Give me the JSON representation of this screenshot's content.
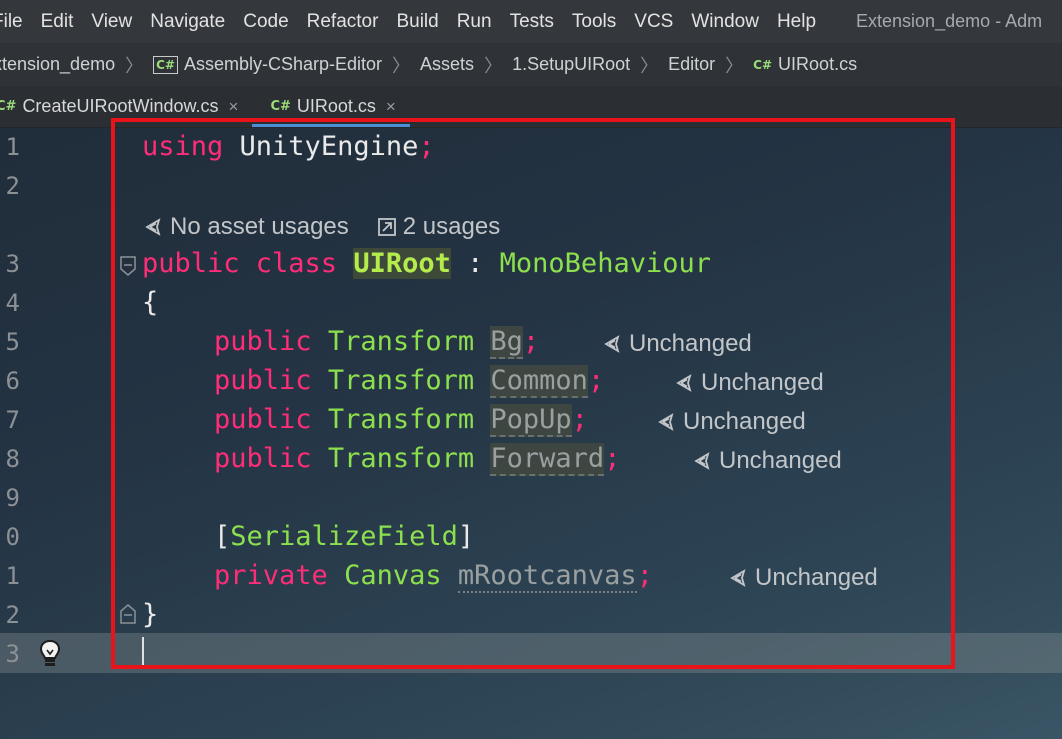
{
  "menu": {
    "items": [
      {
        "name": "menu-file",
        "label": "File"
      },
      {
        "name": "menu-edit",
        "label": "Edit"
      },
      {
        "name": "menu-view",
        "label": "View"
      },
      {
        "name": "menu-navigate",
        "label": "Navigate"
      },
      {
        "name": "menu-code",
        "label": "Code"
      },
      {
        "name": "menu-refactor",
        "label": "Refactor"
      },
      {
        "name": "menu-build",
        "label": "Build"
      },
      {
        "name": "menu-run",
        "label": "Run"
      },
      {
        "name": "menu-tests",
        "label": "Tests"
      },
      {
        "name": "menu-tools",
        "label": "Tools"
      },
      {
        "name": "menu-vcs",
        "label": "VCS"
      },
      {
        "name": "menu-window",
        "label": "Window"
      },
      {
        "name": "menu-help",
        "label": "Help"
      }
    ],
    "window_title": "Extension_demo - Adm"
  },
  "breadcrumb": {
    "items": [
      "xtension_demo",
      "Assembly-CSharp-Editor",
      "Assets",
      "1.SetupUIRoot",
      "Editor",
      "UIRoot.cs"
    ],
    "separator": "〉"
  },
  "tabs": [
    {
      "label": "CreateUIRootWindow.cs",
      "active": false
    },
    {
      "label": "UIRoot.cs",
      "active": true
    }
  ],
  "icons": {
    "cs": "C#",
    "close": "×"
  },
  "gutter": [
    "1",
    "2",
    "3",
    "4",
    "5",
    "6",
    "7",
    "8",
    "9",
    "0",
    "1",
    "2",
    "3"
  ],
  "code": {
    "l1_kw": "using",
    "l1_ns": " UnityEngine",
    "l1_semi": ";",
    "usages_none": "No asset usages",
    "usages_count": "2 usages",
    "l3_kw": "public class ",
    "l3_cls": "UIRoot",
    "l3_colon": " : ",
    "l3_base": "MonoBehaviour",
    "l4": "{",
    "kw_public": "public",
    "type_transform": "Transform",
    "f1": "Bg",
    "f2": "Common",
    "f3": "PopUp",
    "f4": "Forward",
    "semi": ";",
    "attr_open": "[",
    "attr": "SerializeField",
    "attr_close": "]",
    "kw_private": "private",
    "type_canvas": "Canvas",
    "f5": "mRootcanvas",
    "l12": "}",
    "unchanged": "Unchanged"
  },
  "colors": {
    "highlight_box": "#e8141a",
    "keyword": "#ff2d78",
    "type": "#8de04d"
  }
}
